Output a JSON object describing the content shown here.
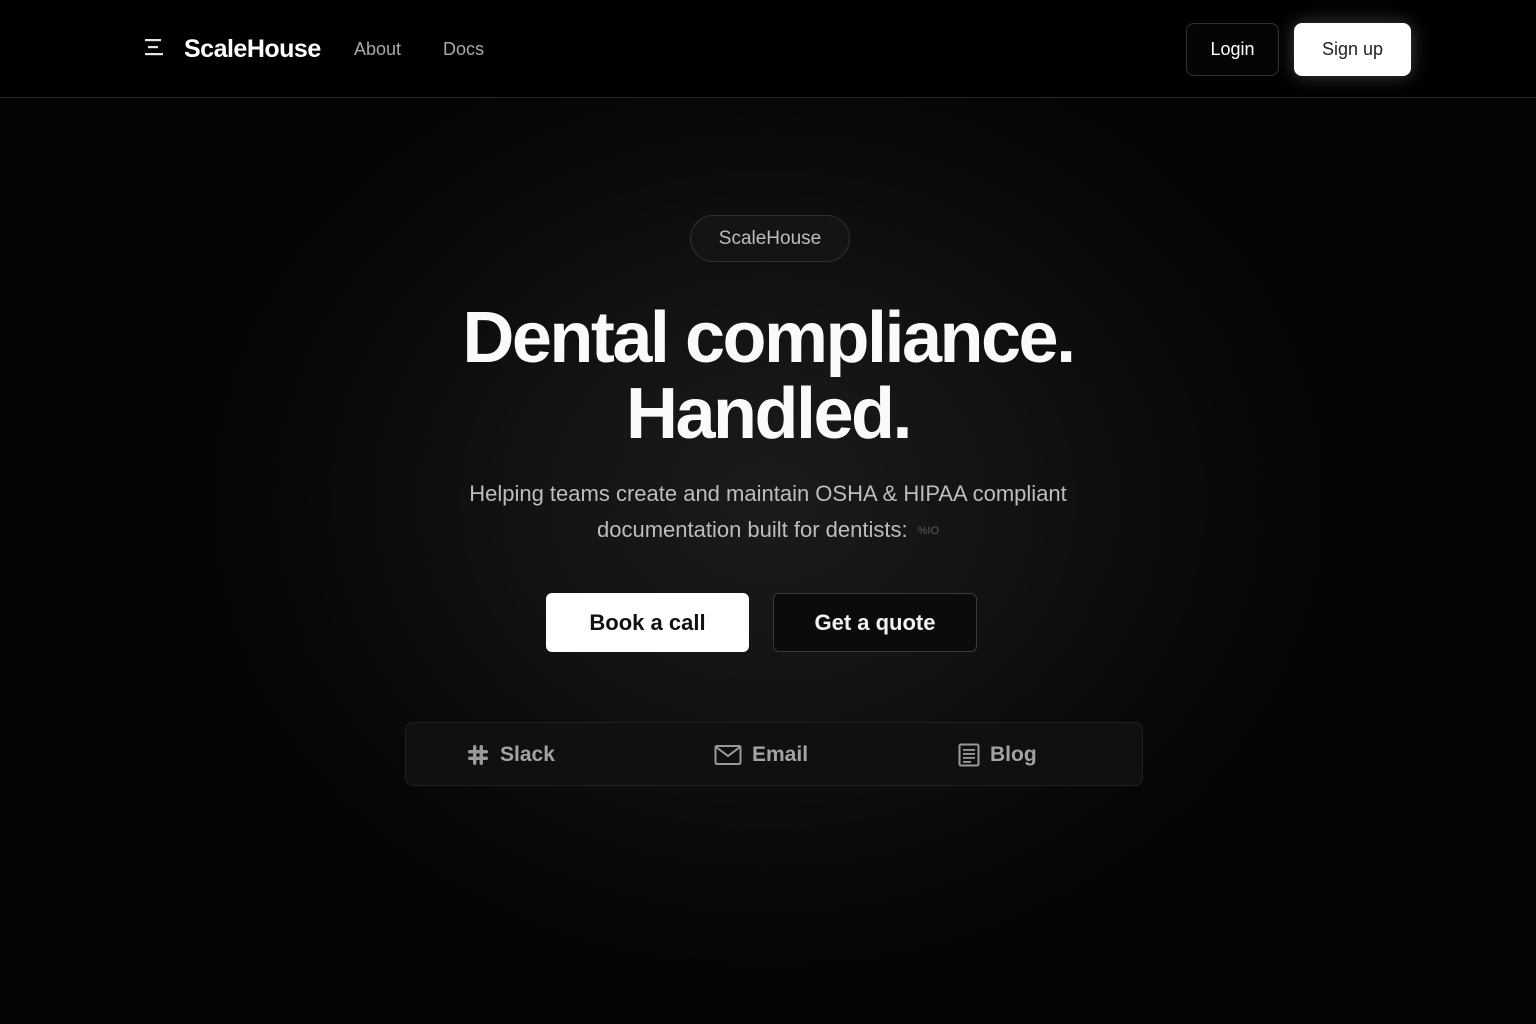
{
  "nav": {
    "brand": "ScaleHouse",
    "links": [
      {
        "label": "About"
      },
      {
        "label": "Docs"
      }
    ],
    "login_label": "Login",
    "signup_label": "Sign up"
  },
  "hero": {
    "pill": "ScaleHouse",
    "headline_line1": "Dental compliance.",
    "headline_line2": "Handled.",
    "subtext_line1": "Helping teams create and maintain OSHA & HIPAA compliant",
    "subtext_line2": "documentation built for dentists:",
    "subtext_small": "%IO",
    "primary_cta": "Book a call",
    "secondary_cta": "Get a quote"
  },
  "channels": [
    {
      "label": "Slack",
      "icon": "slack-icon"
    },
    {
      "label": "Email",
      "icon": "mail-icon"
    },
    {
      "label": "Blog",
      "icon": "document-icon"
    }
  ],
  "colors": {
    "background": "#050505",
    "primary_button": "#ffffff",
    "text": "#f2f2f2",
    "muted_text": "#a9a9a9"
  }
}
